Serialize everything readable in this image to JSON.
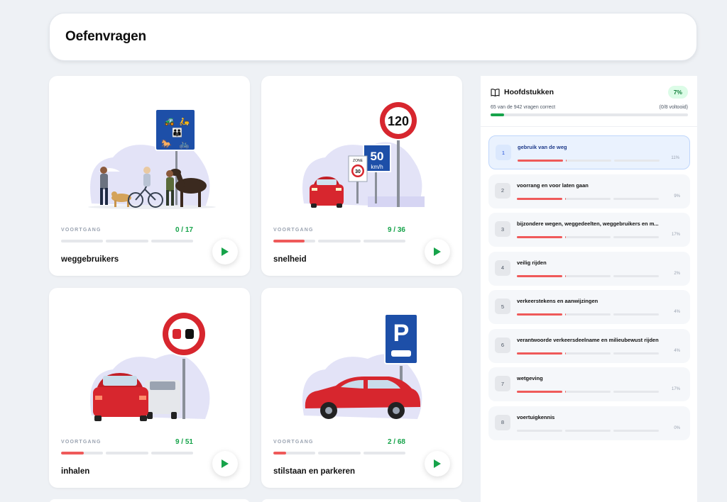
{
  "header": {
    "title": "Oefenvragen"
  },
  "cards": [
    {
      "title": "weggebruikers",
      "progress_label": "VOORTGANG",
      "count": "0 / 17",
      "fraction": 0.0,
      "illustration": "road-users-scene-icon"
    },
    {
      "title": "snelheid",
      "progress_label": "VOORTGANG",
      "count": "9 / 36",
      "fraction": 0.25,
      "illustration": "speed-signs-scene-icon"
    },
    {
      "title": "inhalen",
      "progress_label": "VOORTGANG",
      "count": "9 / 51",
      "fraction": 0.18,
      "illustration": "overtaking-scene-icon"
    },
    {
      "title": "stilstaan en parkeren",
      "progress_label": "VOORTGANG",
      "count": "2 / 68",
      "fraction": 0.03,
      "illustration": "parking-scene-icon"
    }
  ],
  "sidebar": {
    "title": "Hoofdstukken",
    "percent_badge": "7%",
    "summary": "65 van de 942 vragen correct",
    "completed": "(0/8 voltooid)",
    "overall_fraction": 0.07,
    "chapters": [
      {
        "num": "1",
        "name": "gebruik van de weg",
        "pct": "11%",
        "fraction": 0.11,
        "active": true
      },
      {
        "num": "2",
        "name": "voorrang en voor laten gaan",
        "pct": "9%",
        "fraction": 0.09
      },
      {
        "num": "3",
        "name": "bijzondere wegen, weggedeelten, weggebruikers en m...",
        "pct": "17%",
        "fraction": 0.17
      },
      {
        "num": "4",
        "name": "veilig rijden",
        "pct": "2%",
        "fraction": 0.02
      },
      {
        "num": "5",
        "name": "verkeerstekens en aanwijzingen",
        "pct": "4%",
        "fraction": 0.04
      },
      {
        "num": "6",
        "name": "verantwoorde verkeersdeelname en milieubewust rijden",
        "pct": "4%",
        "fraction": 0.04
      },
      {
        "num": "7",
        "name": "wetgeving",
        "pct": "17%",
        "fraction": 0.17
      },
      {
        "num": "8",
        "name": "voertuigkennis",
        "pct": "0%",
        "fraction": 0.0
      }
    ]
  },
  "colors": {
    "accent_green": "#16a34a",
    "progress_red": "#ef5a5a",
    "active_blue": "#1e3a8a"
  }
}
